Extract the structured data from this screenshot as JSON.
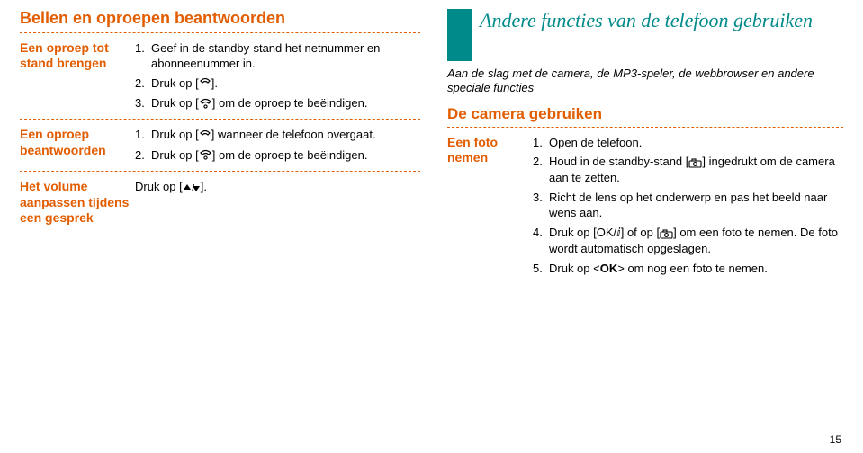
{
  "left": {
    "heading": "Bellen en oproepen beantwoorden",
    "groups": [
      {
        "label": "Een oproep tot stand brengen",
        "steps": [
          {
            "n": "1.",
            "text_before": "Geef in de standby-stand het netnummer en abonneenummer in."
          },
          {
            "n": "2.",
            "text_before": "Druk op [",
            "icon": "call",
            "text_after": "]."
          },
          {
            "n": "3.",
            "text_before": "Druk op [",
            "icon": "end",
            "text_after": "] om de oproep te beëindigen."
          }
        ]
      },
      {
        "label": "Een oproep beantwoorden",
        "steps": [
          {
            "n": "1.",
            "text_before": "Druk op [",
            "icon": "call",
            "text_after": "] wanneer de telefoon overgaat."
          },
          {
            "n": "2.",
            "text_before": "Druk op [",
            "icon": "end",
            "text_after": "] om de oproep te beëindigen."
          }
        ]
      },
      {
        "label": "Het volume aanpassen tijdens een gesprek",
        "single": {
          "text_before": "Druk op [",
          "icon": "updown",
          "text_after": "]."
        }
      }
    ]
  },
  "right": {
    "section_title": "Andere functies van de telefoon gebruiken",
    "intro": "Aan de slag met de camera, de MP3-speler, de webbrowser en andere speciale functies",
    "sub_heading": "De camera gebruiken",
    "group_label": "Een foto nemen",
    "steps": [
      {
        "n": "1.",
        "text": "Open de telefoon."
      },
      {
        "n": "2.",
        "text_before": "Houd in de standby-stand [",
        "icon": "camera",
        "text_after": "] ingedrukt om de camera aan te zetten."
      },
      {
        "n": "3.",
        "text": "Richt de lens op het onderwerp en pas het beeld naar wens aan."
      },
      {
        "n": "4.",
        "text_before": "Druk op [",
        "icon_text": "OK/ⅈ",
        "text_mid": "] of op [",
        "icon": "camera",
        "text_after": "] om een foto te nemen. De foto wordt automatisch opgeslagen."
      },
      {
        "n": "5.",
        "text_before": "Druk op <",
        "bold": "OK",
        "text_after": "> om nog een foto te nemen."
      }
    ]
  },
  "page_number": "15"
}
